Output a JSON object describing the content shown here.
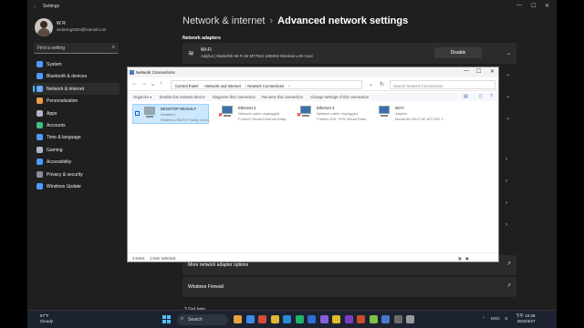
{
  "titlebar": {
    "title": "Settings",
    "back": "←",
    "minimize": "—",
    "maximize": "☐",
    "close": "✕"
  },
  "profile": {
    "name": "W R",
    "email": "wrdasing0304@hotmail.com"
  },
  "search": {
    "placeholder": "Find a setting"
  },
  "nav": [
    {
      "label": "System",
      "color": "#4c9bff"
    },
    {
      "label": "Bluetooth & devices",
      "color": "#4c9bff"
    },
    {
      "label": "Network & internet",
      "color": "#6aa9ff"
    },
    {
      "label": "Personalization",
      "color": "#e89b4c"
    },
    {
      "label": "Apps",
      "color": "#b0b7c9"
    },
    {
      "label": "Accounts",
      "color": "#3fbf7f"
    },
    {
      "label": "Time & language",
      "color": "#4c9bff"
    },
    {
      "label": "Gaming",
      "color": "#b0b7c9"
    },
    {
      "label": "Accessibility",
      "color": "#4c9bff"
    },
    {
      "label": "Privacy & security",
      "color": "#8a8f9c"
    },
    {
      "label": "Windows Update",
      "color": "#4c9bff"
    }
  ],
  "breadcrumb": {
    "parent": "Network & internet",
    "separator": "›",
    "current": "Advanced network settings"
  },
  "network_adapters": {
    "heading": "Network adapters",
    "wifi": {
      "name": "Wi-Fi",
      "description": "Aalyfun | MediaTek Wi-Fi 6E MT7922 160MHz Wireless LAN Card",
      "button": "Disable"
    }
  },
  "bottom": {
    "more_options": "More network adapter options",
    "firewall": "Windows Firewall",
    "help": "Get help"
  },
  "netconn": {
    "title": "Network Connections",
    "path": [
      "Control Panel",
      "Network and Internet",
      "Network Connections"
    ],
    "search_placeholder": "Search Network Connections",
    "commands": [
      "Organize ▾",
      "Enable this network device",
      "Diagnose this connection",
      "Rename this connection",
      "Change settings of this connection"
    ],
    "adapters": [
      {
        "name": "DESKTOP-9K01HLF",
        "status": "Disabled",
        "device": "Realtek USB FE Family Contr...",
        "selected": true,
        "error": false
      },
      {
        "name": "Ethernet 2",
        "status": "Network cable unplugged",
        "device": "Fortinet Virtual Ethernet Adap...",
        "selected": false,
        "error": true
      },
      {
        "name": "Ethernet 3",
        "status": "Network cable unplugged",
        "device": "Fortinet SSL VPN Virtual Ether...",
        "selected": false,
        "error": true
      },
      {
        "name": "Wi-Fi",
        "status": "Aalyfun",
        "device": "MediaTek Wi-Fi 6E MT7922 1...",
        "selected": false,
        "error": false
      }
    ],
    "status": {
      "items": "4 items",
      "selected": "1 item selected"
    }
  },
  "taskbar": {
    "weather_temp": "67°F",
    "weather_desc": "Cloudy",
    "search": "Search",
    "tray_lang": "ENG",
    "time": "下午 10:26",
    "date": "2023/3/27",
    "apps": [
      "#e8a33d",
      "#3b8beb",
      "#d94a3a",
      "#e2b437",
      "#2a8ad6",
      "#1fb26a",
      "#2d6fd6",
      "#8a5cd6",
      "#e0b92a",
      "#7a3fc0",
      "#c94b2b",
      "#7bc144",
      "#4a78c8",
      "#6b6b6b",
      "#9a9a9a"
    ]
  }
}
